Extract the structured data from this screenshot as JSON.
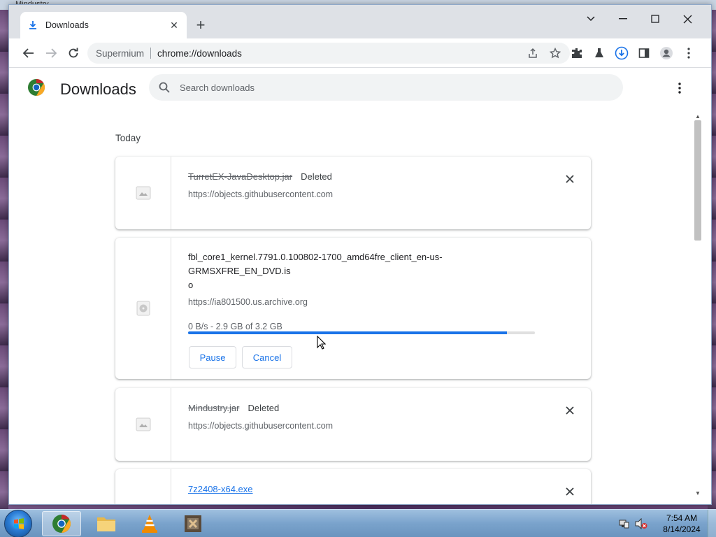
{
  "background": {
    "window_title": "Mindustry"
  },
  "tab": {
    "title": "Downloads",
    "close_icon": "close-icon"
  },
  "toolbar": {
    "site_name": "Supermium",
    "url": "chrome://downloads"
  },
  "page": {
    "title": "Downloads",
    "search_placeholder": "Search downloads",
    "date_group": "Today"
  },
  "downloads": [
    {
      "filename": "TurretEX-JavaDesktop.jar",
      "status": "Deleted",
      "source": "https://objects.githubusercontent.com"
    },
    {
      "filename_line1": "fbl_core1_kernel.7791.0.100802-1700_amd64fre_client_en-us-GRMSXFRE_EN_DVD.is",
      "filename_line2": "o",
      "source": "https://ia801500.us.archive.org",
      "progress_text": "0 B/s - 2.9 GB of 3.2 GB",
      "progress_fraction": 0.92,
      "pause_label": "Pause",
      "cancel_label": "Cancel"
    },
    {
      "filename": "Mindustry.jar",
      "status": "Deleted",
      "source": "https://objects.githubusercontent.com"
    },
    {
      "filename": "7z2408-x64.exe"
    }
  ],
  "taskbar": {
    "time": "7:54 AM",
    "date": "8/14/2024"
  },
  "colors": {
    "accent": "#1a73e8",
    "tabstrip": "#dee1e6",
    "omnibox": "#f1f3f4"
  }
}
